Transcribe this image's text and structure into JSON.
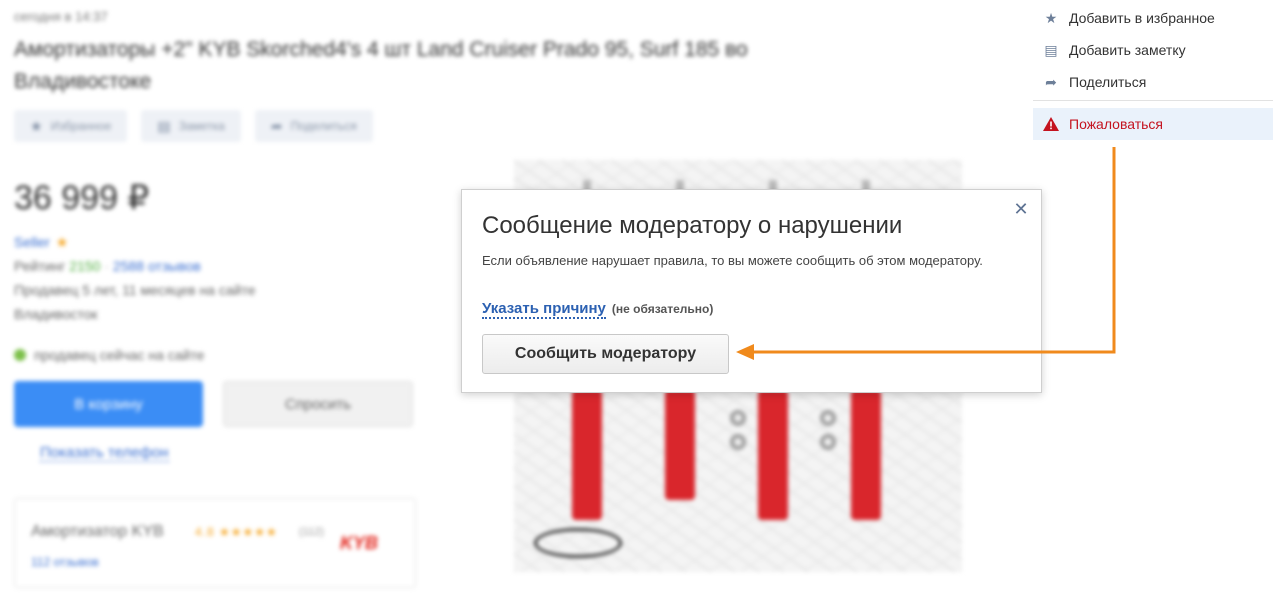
{
  "listing": {
    "timestamp": "сегодня в 14:37",
    "title": "Амортизаторы +2\" KYB Skorched4's 4 шт Land Cruiser Prado 95, Surf 185 во Владивостоке",
    "actions": [
      {
        "label": "Избранное",
        "icon": "star-icon"
      },
      {
        "label": "Заметка",
        "icon": "note-icon"
      },
      {
        "label": "Поделиться",
        "icon": "share-icon"
      }
    ],
    "price": "36 999 ₽",
    "seller": {
      "name": "Seller",
      "rating_label": "Рейтинг",
      "rating_value": "2150",
      "reviews": "2588 отзывов",
      "tenure": "Продавец 5 лет, 11 месяцев на сайте",
      "city": "Владивосток",
      "online": "продавец сейчас на сайте"
    },
    "buttons": {
      "cart": "В корзину",
      "ask": "Спросить",
      "show_phone": "Показать телефон"
    },
    "product_card": {
      "title": "Амортизатор KYB",
      "stars": "4.8 ★★★★★",
      "count": "(112)",
      "reviews": "112 отзывов",
      "logo": "KYB"
    }
  },
  "menu": {
    "items": [
      {
        "label": "Добавить в избранное",
        "icon": "star-icon"
      },
      {
        "label": "Добавить заметку",
        "icon": "note-icon"
      },
      {
        "label": "Поделиться",
        "icon": "share-icon"
      }
    ],
    "report": {
      "label": "Пожаловаться",
      "icon": "warning-icon"
    }
  },
  "modal": {
    "title": "Сообщение модератору о нарушении",
    "description": "Если объявление нарушает правила, то вы можете сообщить об этом модератору.",
    "reason_link": "Указать причину",
    "reason_note": "(не обязательно)",
    "submit": "Сообщить модератору",
    "close_icon": "close-icon"
  },
  "colors": {
    "annotation_arrow": "#f08a1c",
    "report_text": "#c4131f",
    "link": "#2c61b2"
  }
}
